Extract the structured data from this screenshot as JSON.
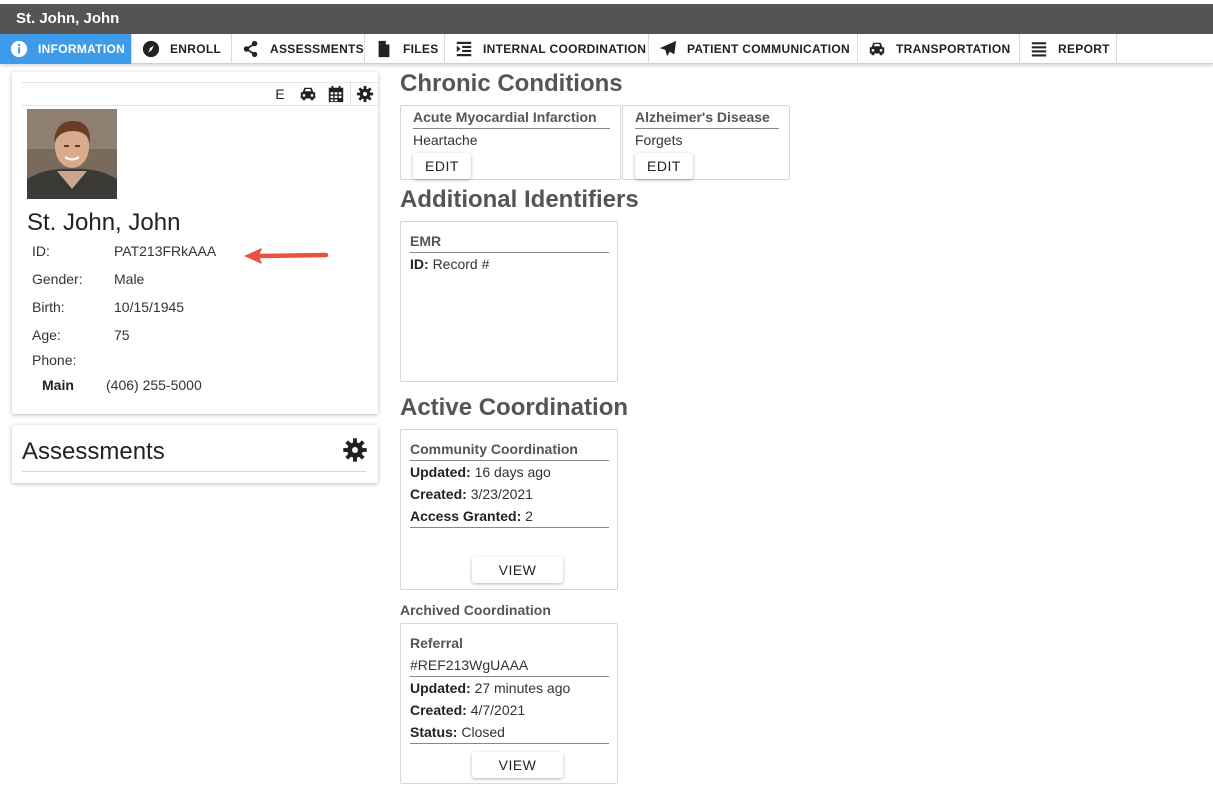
{
  "title_bar": {
    "title": "St. John, John"
  },
  "nav": {
    "items": [
      {
        "label": "INFORMATION",
        "icon": "info-icon"
      },
      {
        "label": "ENROLL",
        "icon": "compass-icon"
      },
      {
        "label": "ASSESSMENTS",
        "icon": "share-icon"
      },
      {
        "label": "FILES",
        "icon": "file-icon"
      },
      {
        "label": "INTERNAL COORDINATION",
        "icon": "indent-icon"
      },
      {
        "label": "PATIENT COMMUNICATION",
        "icon": "paper-plane-icon"
      },
      {
        "label": "TRANSPORTATION",
        "icon": "car-icon"
      },
      {
        "label": "REPORT",
        "icon": "list-icon"
      }
    ],
    "active": "INFORMATION"
  },
  "profile": {
    "toolbar_letter": "E",
    "name": "St. John, John",
    "fields": [
      {
        "label": "ID:",
        "value": "PAT213FRkAAA"
      },
      {
        "label": "Gender:",
        "value": "Male"
      },
      {
        "label": "Birth:",
        "value": "10/15/1945"
      },
      {
        "label": "Age:",
        "value": "75"
      },
      {
        "label": "Phone:",
        "value": ""
      }
    ],
    "phone_main": {
      "label": "Main",
      "value": "(406) 255-5000"
    }
  },
  "assessments": {
    "title": "Assessments"
  },
  "chronic": {
    "heading": "Chronic Conditions",
    "items": [
      {
        "title": "Acute Myocardial Infarction",
        "note": "Heartache",
        "button": "EDIT"
      },
      {
        "title": "Alzheimer's Disease",
        "note": "Forgets",
        "button": "EDIT"
      }
    ]
  },
  "identifiers": {
    "heading": "Additional Identifiers",
    "items": [
      {
        "title": "EMR",
        "id_label": "ID:",
        "id_value": "Record #"
      }
    ]
  },
  "active": {
    "heading": "Active Coordination",
    "card": {
      "title": "Community Coordination",
      "updated_label": "Updated:",
      "updated_value": "16 days ago",
      "created_label": "Created:",
      "created_value": "3/23/2021",
      "access_label": "Access Granted:",
      "access_value": "2",
      "button": "VIEW"
    }
  },
  "archived": {
    "heading": "Archived Coordination",
    "card": {
      "title": "Referral",
      "ref": "#REF213WgUAAA",
      "updated_label": "Updated:",
      "updated_value": "27 minutes ago",
      "created_label": "Created:",
      "created_value": "4/7/2021",
      "status_label": "Status:",
      "status_value": "Closed",
      "button": "VIEW"
    }
  },
  "colors": {
    "accent": "#3d9be9",
    "title_bar": "#545454",
    "arrow": "#e8533f"
  }
}
